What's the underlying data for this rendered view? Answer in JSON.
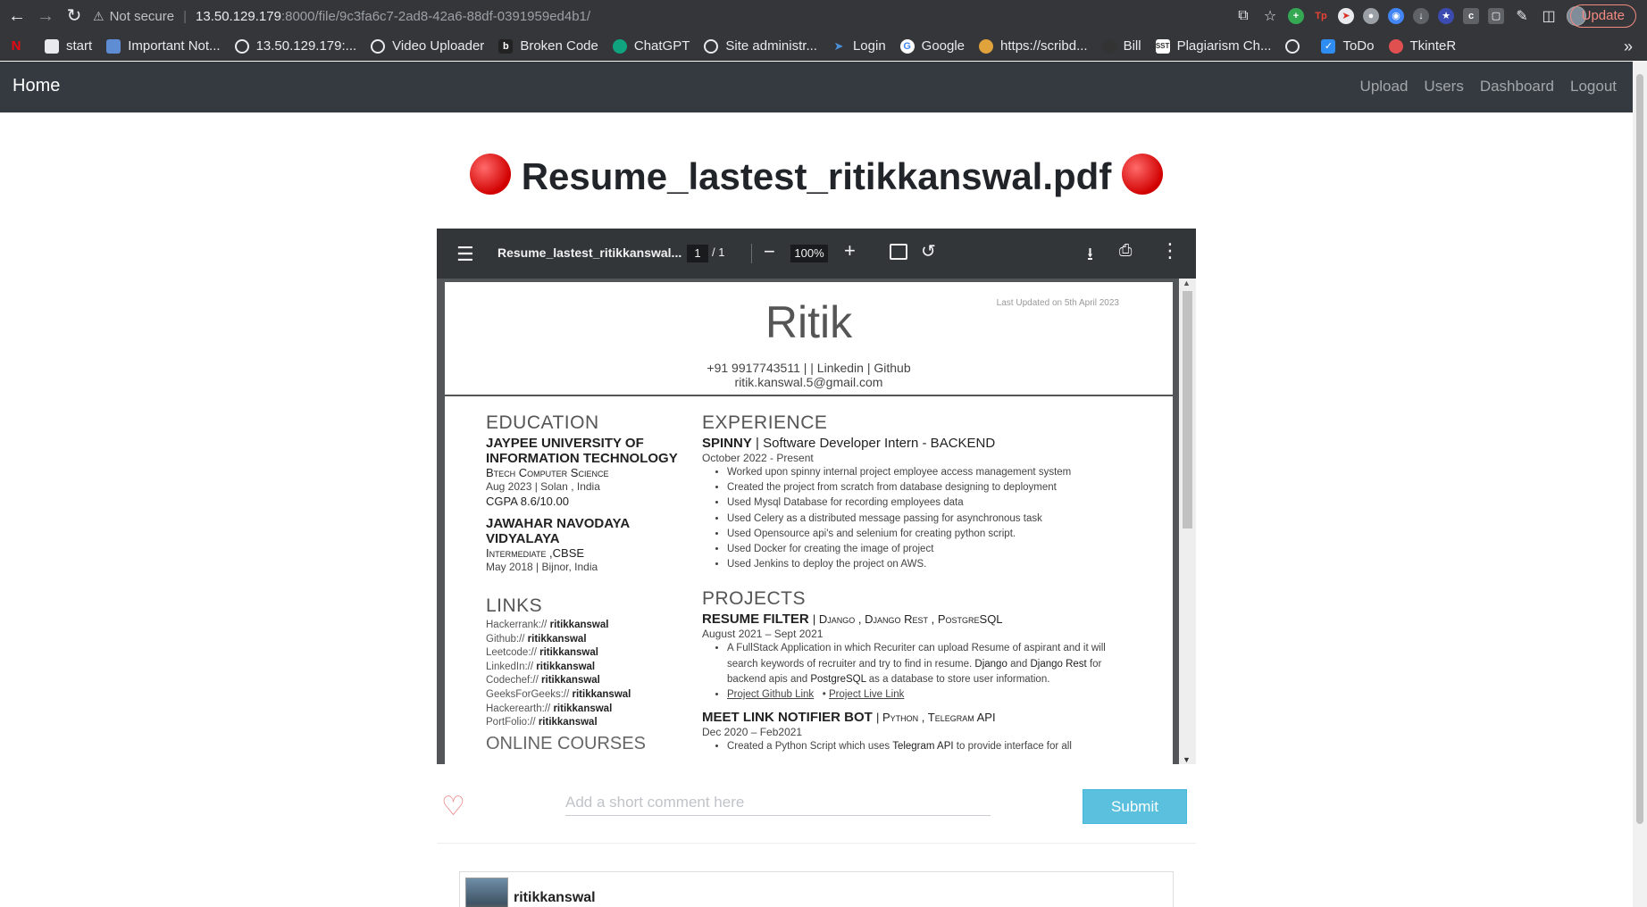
{
  "browser": {
    "security_label": "Not secure",
    "url_host": "13.50.129.179",
    "url_path": ":8000/file/9c3fa6c7-2ad8-42a6-88df-0391959ed4b1/",
    "update_label": "Update",
    "bookmarks": [
      {
        "label": "start",
        "icon": "folder-icon",
        "color": "#e8eaed"
      },
      {
        "label": "Important Not...",
        "icon": "doc-icon",
        "color": "#5f8dd3"
      },
      {
        "label": "13.50.129.179:...",
        "icon": "globe-icon",
        "color": "#e8eaed"
      },
      {
        "label": "Video Uploader",
        "icon": "globe-icon",
        "color": "#e8eaed"
      },
      {
        "label": "Broken Code",
        "icon": "code-icon",
        "color": "#222222"
      },
      {
        "label": "ChatGPT",
        "icon": "chatgpt-icon",
        "color": "#10a37f"
      },
      {
        "label": "Site administr...",
        "icon": "globe-icon",
        "color": "#e8eaed"
      },
      {
        "label": "Login",
        "icon": "arrow-icon",
        "color": "#4a90d9"
      },
      {
        "label": "Google",
        "icon": "google-icon",
        "color": "#ffffff"
      },
      {
        "label": "https://scribd...",
        "icon": "scribd-icon",
        "color": "#e0a23b"
      },
      {
        "label": "Bill",
        "icon": "bill-icon",
        "color": "#333333"
      },
      {
        "label": "Plagiarism Ch...",
        "icon": "sst-icon",
        "color": "#ffffff"
      },
      {
        "label": "",
        "icon": "globe-icon",
        "color": "#e8eaed"
      },
      {
        "label": "ToDo",
        "icon": "todo-icon",
        "color": "#2f8cf0"
      },
      {
        "label": "TkinteR",
        "icon": "tkinter-icon",
        "color": "#e05050"
      }
    ]
  },
  "site": {
    "brand": "Home",
    "nav": [
      "Upload",
      "Users",
      "Dashboard",
      "Logout"
    ]
  },
  "file": {
    "title": "Resume_lastest_ritikkanswal.pdf",
    "title_marker": "red-circle-icon"
  },
  "pdf_viewer": {
    "filename": "Resume_lastest_ritikkanswal...",
    "page_current": "1",
    "page_total": "/  1",
    "zoom": "100%"
  },
  "resume": {
    "updated": "Last Updated on 5th April 2023",
    "name": "Ritik",
    "contact_line1": "+91 9917743511 |  | Linkedin  | Github",
    "contact_line2": "ritik.kanswal.5@gmail.com",
    "education_heading": "EDUCATION",
    "edu1_name": "JAYPEE UNIVERSITY OF INFORMATION TECHNOLOGY",
    "edu1_degree": "Btech Computer Science",
    "edu1_meta": "Aug 2023 | Solan , India",
    "edu1_grade": "CGPA 8.6/10.00",
    "edu2_name": "JAWAHAR NAVODAYA VIDYALAYA",
    "edu2_degree": "Intermediate ,CBSE",
    "edu2_meta": "May 2018 | Bijnor, India",
    "links_heading": "LINKS",
    "links": [
      {
        "site": "Hackerrank://",
        "handle": "ritikkanswal"
      },
      {
        "site": "Github://",
        "handle": "ritikkanswal"
      },
      {
        "site": "Leetcode://",
        "handle": "ritikkanswal"
      },
      {
        "site": "LinkedIn://",
        "handle": "ritikkanswal"
      },
      {
        "site": "Codechef://",
        "handle": "ritikkanswal"
      },
      {
        "site": "GeeksForGeeks://",
        "handle": "ritikkanswal"
      },
      {
        "site": "Hackerearth://",
        "handle": "ritikkanswal"
      },
      {
        "site": "PortFolio://",
        "handle": "ritikkanswal"
      }
    ],
    "courses_heading": "ONLINE COURSES",
    "experience_heading": "EXPERIENCE",
    "job_company": "SPINNY",
    "job_role": "| Software Developer Intern - BACKEND",
    "job_dates": "October 2022 - Present",
    "job_bullets": [
      "Worked upon spinny internal project employee access management system",
      "Created the project from scratch from database designing to deployment",
      "Used Mysql Database for recording employees data",
      "Used Celery as a distributed message passing for asynchronous task",
      "Used Opensource api's and selenium for creating python script.",
      "Used Docker for creating the image of project",
      "Used Jenkins to deploy the project on AWS."
    ],
    "projects_heading": "PROJECTS",
    "proj1_name": "RESUME FILTER",
    "proj1_stack": "| Django , Django Rest , PostgreSQL",
    "proj1_dates": "August 2021 – Sept 2021",
    "proj1_desc_a": "A FullStack Application in which Recuriter can upload Resume of aspirant and it will search keywords of recruiter and try to find in resume.",
    "proj1_desc_b": "Django",
    "proj1_desc_c": "and",
    "proj1_desc_d": "Django Rest",
    "proj1_desc_e": "for backend apis and",
    "proj1_desc_f": "PostgreSQL",
    "proj1_desc_g": "as a database to store user information.",
    "proj1_link1": "Project Github Link",
    "proj1_link2": "Project Live Link",
    "proj2_name": "MEET LINK NOTIFIER BOT",
    "proj2_stack": "| Python , Telegram API",
    "proj2_dates": "Dec 2020 – Feb2021",
    "proj2_desc_a": "Created a Python Script which uses",
    "proj2_desc_b": "Telegram API",
    "proj2_desc_c": "to provide interface for all"
  },
  "comment_form": {
    "placeholder": "Add a short comment here",
    "value": "",
    "submit_label": "Submit",
    "like_icon": "heart-icon"
  },
  "comments": [
    {
      "user": "ritikkanswal"
    }
  ],
  "colors": {
    "navbar": "#343a40",
    "submit": "#5bc0de",
    "heart": "#f08080",
    "title_marker": "#d10000"
  }
}
